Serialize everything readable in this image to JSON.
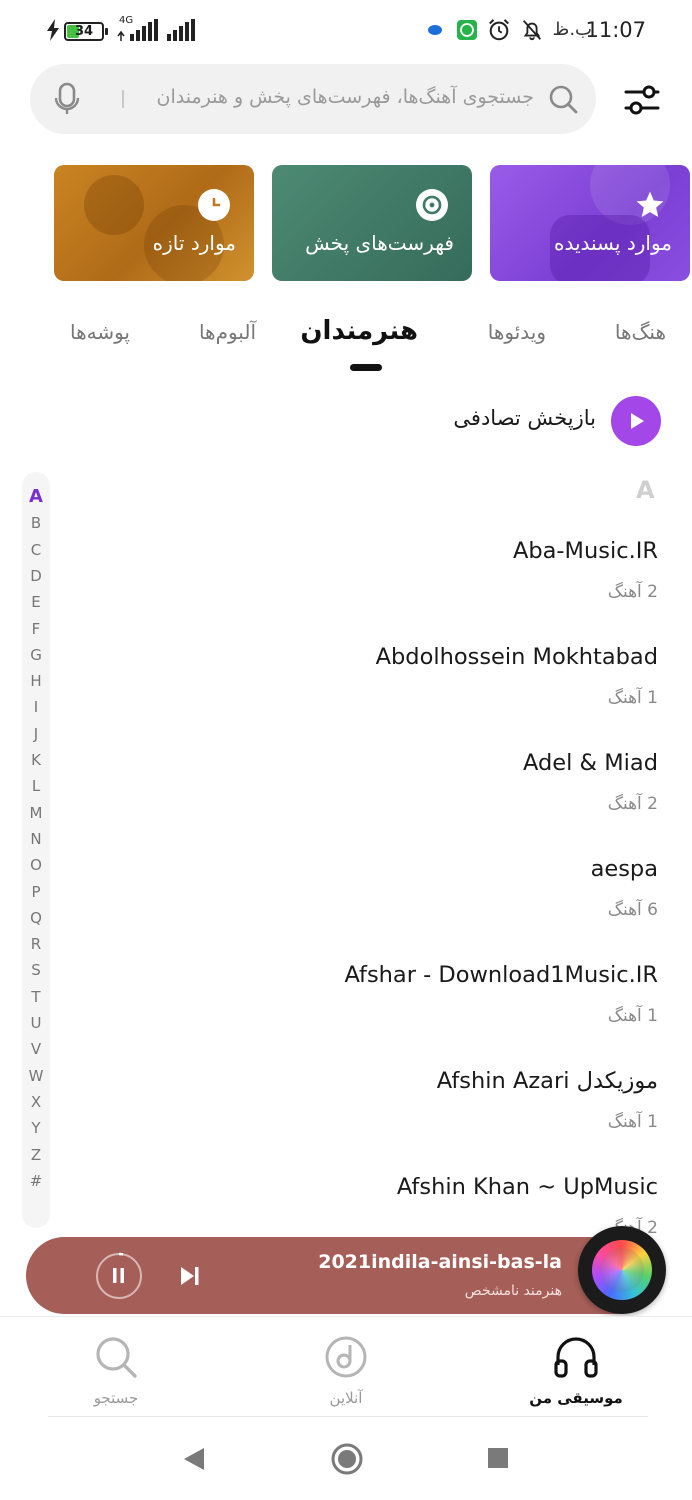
{
  "status_bar": {
    "time": "11:07",
    "ampm": "ب.ظ",
    "battery": "34",
    "network": "4G"
  },
  "search": {
    "placeholder": "جستجوی آهنگ‌ها، فهرست‌های پخش و هنرمندان"
  },
  "quick_cards": [
    {
      "label": "موارد پسندیده",
      "icon": "star-icon",
      "color": "#8a4ee0"
    },
    {
      "label": "فهرست‌های پخش",
      "icon": "music-disc-icon",
      "color": "#3f7a66"
    },
    {
      "label": "موارد تازه",
      "icon": "clock-icon",
      "color": "#c07a1f"
    }
  ],
  "tabs": [
    {
      "label": "هنگ‌ها"
    },
    {
      "label": "ویدئوها"
    },
    {
      "label": "هنرمندان",
      "active": true
    },
    {
      "label": "آلبوم‌ها"
    },
    {
      "label": "پوشه‌ها"
    }
  ],
  "shuffle": {
    "label": "بازپخش تصادفی",
    "accent": "#a347e8"
  },
  "section_letter": "A",
  "artists": [
    {
      "name": "Aba-Music.IR",
      "count": "2 آهنگ"
    },
    {
      "name": "Abdolhossein Mokhtabad",
      "count": "1 آهنگ"
    },
    {
      "name": "Adel & Miad",
      "count": "2 آهنگ"
    },
    {
      "name": "aespa",
      "count": "6 آهنگ"
    },
    {
      "name": "Afshar - Download1Music.IR",
      "count": "1 آهنگ"
    },
    {
      "name": "Afshin Azari موزیکدل",
      "count": "1 آهنگ"
    },
    {
      "name": "Afshin Khan ~ UpMusic",
      "count": "2 آهنگ"
    }
  ],
  "alphabet": [
    "A",
    "B",
    "C",
    "D",
    "E",
    "F",
    "G",
    "H",
    "I",
    "J",
    "K",
    "L",
    "M",
    "N",
    "O",
    "P",
    "Q",
    "R",
    "S",
    "T",
    "U",
    "V",
    "W",
    "X",
    "Y",
    "Z",
    "#"
  ],
  "player": {
    "title": "2021indila-ainsi-bas-la",
    "artist": "هنرمند نامشخص",
    "background": "#a65e58"
  },
  "bottom_nav": [
    {
      "label": "موسیقی من",
      "icon": "headphones-icon",
      "active": true
    },
    {
      "label": "آنلاین",
      "icon": "music-note-circle-icon"
    },
    {
      "label": "جستجو",
      "icon": "search-icon"
    }
  ]
}
